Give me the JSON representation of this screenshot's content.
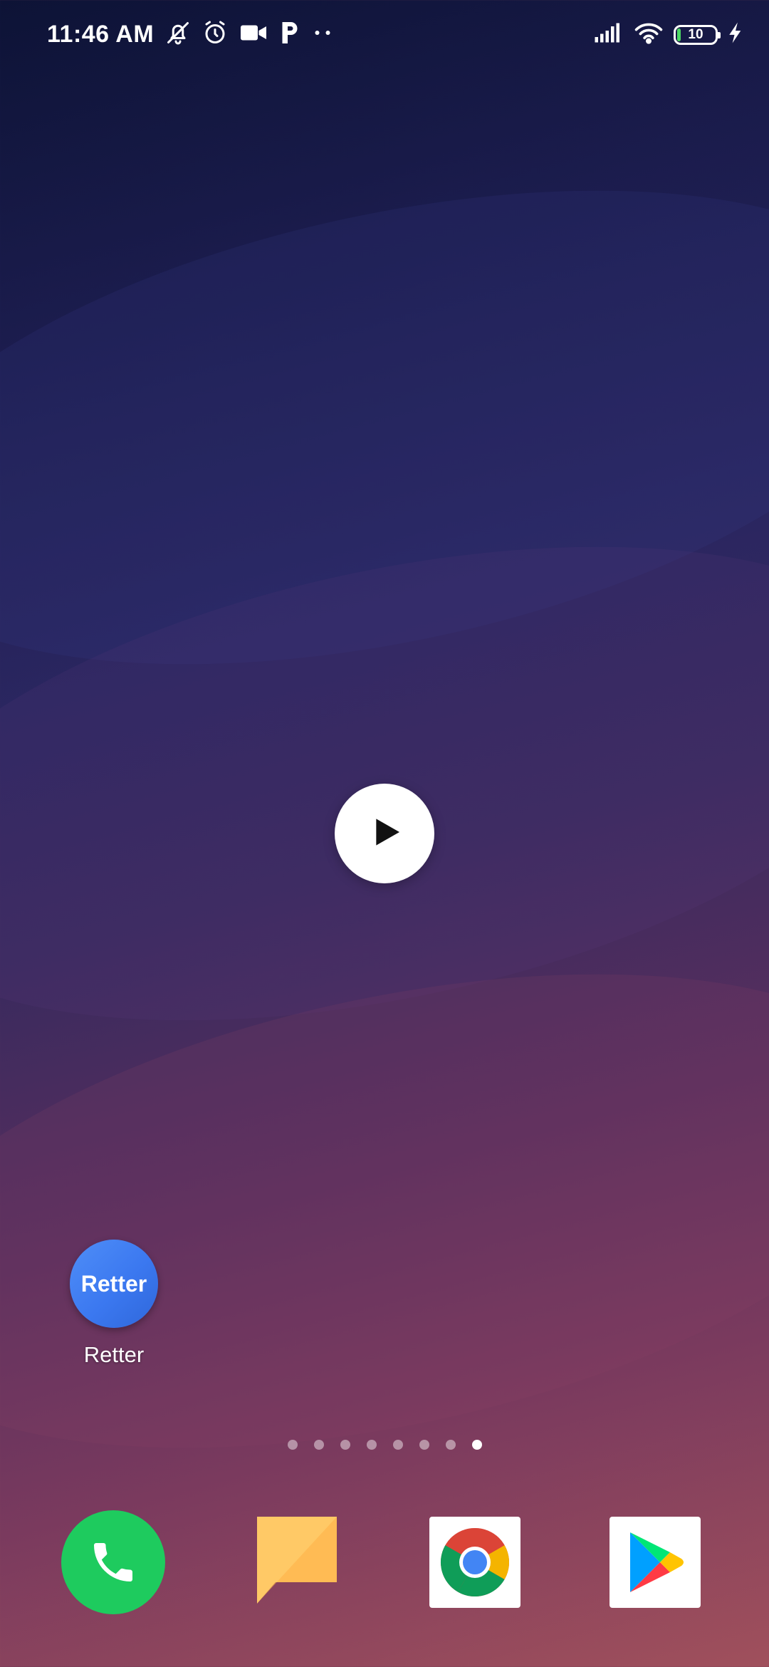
{
  "status_bar": {
    "time": "11:46 AM",
    "icons_left": [
      "muted-bell-icon",
      "alarm-icon",
      "video-camera-icon",
      "parking-p-icon",
      "more-dots-icon"
    ],
    "icons_right": [
      "signal-bars-icon",
      "wifi-icon",
      "battery-icon",
      "charging-bolt-icon"
    ],
    "battery_level": "10",
    "battery_color": "#4cd964"
  },
  "center": {
    "play_icon": "play-icon"
  },
  "home_apps": [
    {
      "label": "Retter",
      "icon_text": "Retter",
      "icon_color": "#3b78f0"
    }
  ],
  "page_indicator": {
    "total_pages": 8,
    "active_page": 8
  },
  "dock": [
    {
      "name": "phone",
      "icon": "phone-icon",
      "color": "#1ecb5e"
    },
    {
      "name": "notes",
      "icon": "notes-icon",
      "color": "#ffc966"
    },
    {
      "name": "chrome",
      "icon": "chrome-icon"
    },
    {
      "name": "play-store",
      "icon": "play-store-icon"
    }
  ]
}
